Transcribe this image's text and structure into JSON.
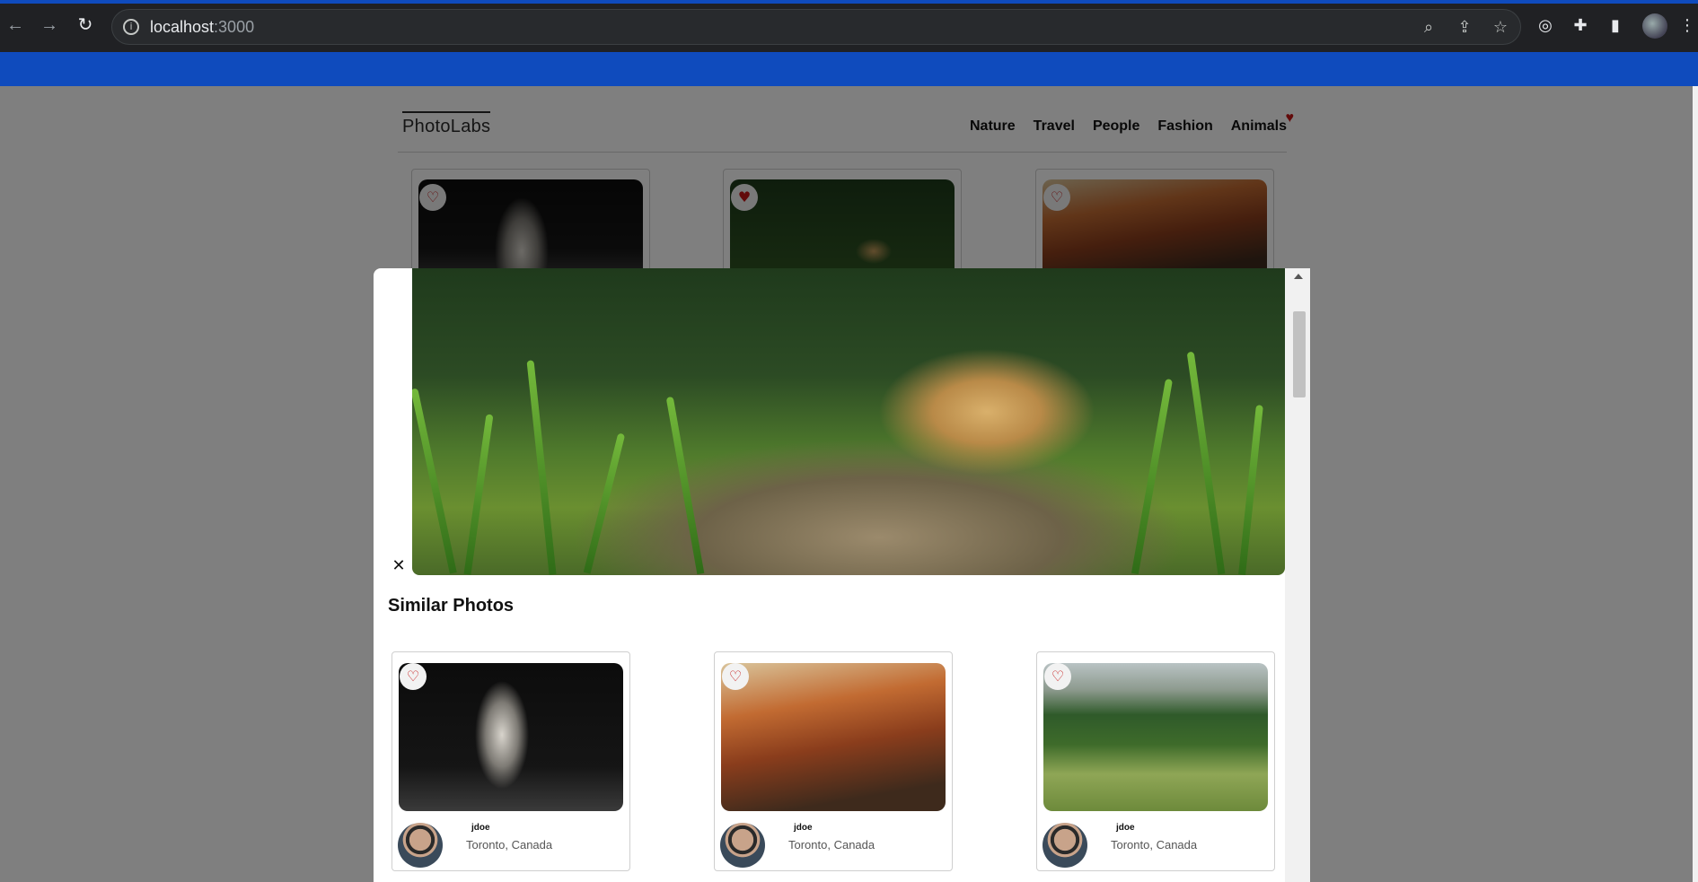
{
  "browser": {
    "url_host": "localhost",
    "url_port": ":3000"
  },
  "app": {
    "logo": "PhotoLabs",
    "topics": [
      "Nature",
      "Travel",
      "People",
      "Fashion",
      "Animals"
    ]
  },
  "modal": {
    "similar_title": "Similar Photos",
    "similar_photos": [
      {
        "username": "jdoe",
        "location": "Toronto, Canada"
      },
      {
        "username": "jdoe",
        "location": "Toronto, Canada"
      },
      {
        "username": "jdoe",
        "location": "Toronto, Canada"
      }
    ]
  },
  "icons": {
    "favourite": "heart-icon",
    "close": "close-icon"
  },
  "colors": {
    "browser_blue": "#0f4bbd",
    "heart_red": "#c41414"
  }
}
